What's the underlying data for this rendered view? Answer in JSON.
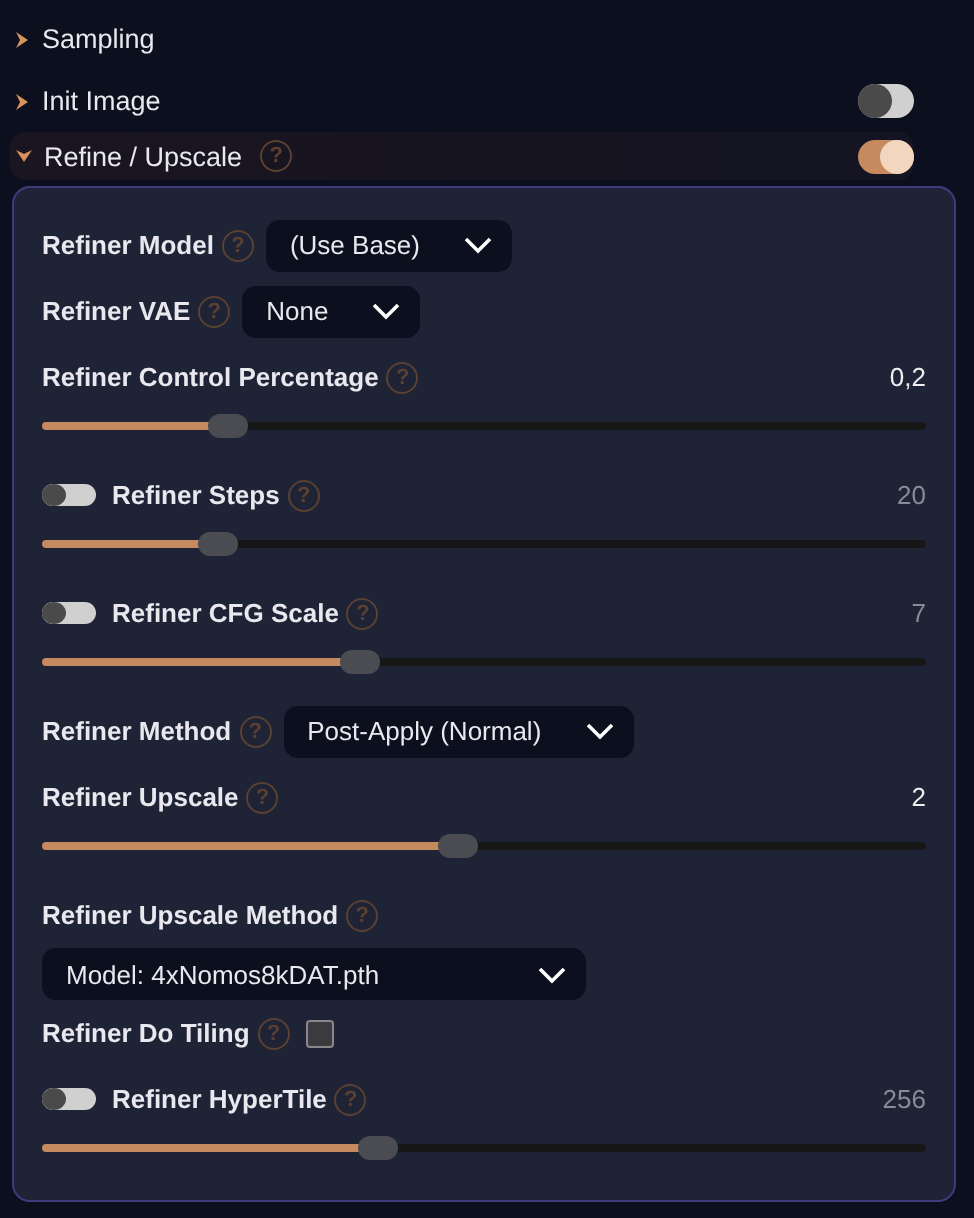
{
  "sections": [
    {
      "title": "Sampling",
      "expanded": false
    },
    {
      "title": "Init Image",
      "expanded": false,
      "toggle": {
        "on": false
      }
    },
    {
      "title": "Refine / Upscale",
      "expanded": true,
      "help": "?",
      "toggle": {
        "on": true
      }
    }
  ],
  "refine_settings": [
    {
      "kind": "select",
      "label": "Refiner Model",
      "help": "?",
      "value": "(Use Base)"
    },
    {
      "kind": "select",
      "label": "Refiner VAE",
      "help": "?",
      "value": "None"
    },
    {
      "kind": "slider",
      "label": "Refiner Control Percentage",
      "help": "?",
      "reading": "0,2",
      "level": 0.21
    },
    {
      "kind": "slider",
      "label": "Refiner Steps",
      "help": "?",
      "reading": "20",
      "level": 0.2,
      "toggle": {
        "on": false
      }
    },
    {
      "kind": "slider",
      "label": "Refiner CFG Scale",
      "help": "?",
      "reading": "7",
      "level": 0.36,
      "toggle": {
        "on": false
      }
    },
    {
      "kind": "select",
      "label": "Refiner Method",
      "help": "?",
      "value": "Post-Apply (Normal)"
    },
    {
      "kind": "slider",
      "label": "Refiner Upscale",
      "help": "?",
      "reading": "2",
      "level": 0.47
    },
    {
      "kind": "select-below",
      "label": "Refiner Upscale Method",
      "help": "?",
      "value": "Model: 4xNomos8kDAT.pth"
    },
    {
      "kind": "checkbox",
      "label": "Refiner Do Tiling",
      "help": "?",
      "checked": false
    },
    {
      "kind": "slider",
      "label": "Refiner HyperTile",
      "help": "?",
      "reading": "256",
      "level": 0.38,
      "toggle": {
        "on": false
      }
    }
  ]
}
